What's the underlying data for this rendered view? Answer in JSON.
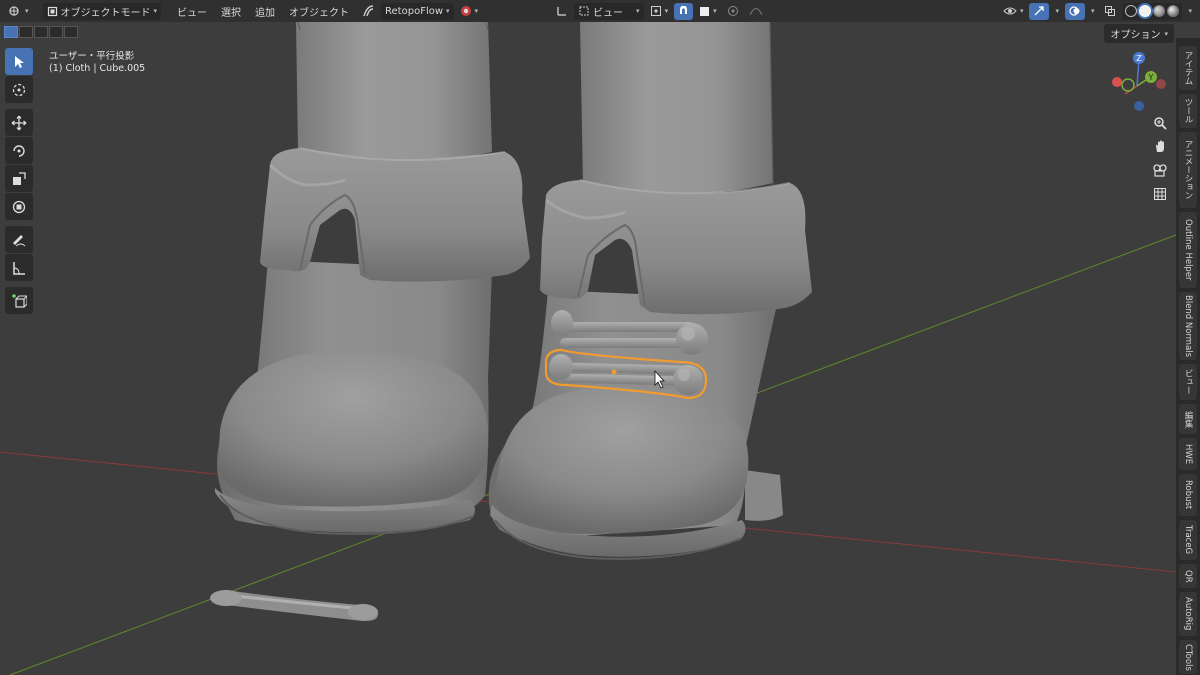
{
  "header": {
    "mode_label": "オブジェクトモード",
    "menus": [
      "ビュー",
      "選択",
      "追加",
      "オブジェクト"
    ],
    "addon_label": "RetopoFlow",
    "view_label": "ビュー"
  },
  "viewport": {
    "view_name": "ユーザー・平行投影",
    "object_info": "(1) Cloth | Cube.005",
    "options_label": "オプション"
  },
  "gizmo": {
    "z": "Z",
    "y": "Y"
  },
  "sidebar": {
    "tabs": [
      "アイテム",
      "ツール",
      "アニメーション",
      "Outline Helper",
      "Blend Normals",
      "ビュー",
      "編集",
      "HWE",
      "Robust",
      "TraceG",
      "QR",
      "AutoRig",
      "CTools"
    ]
  },
  "colors": {
    "header_bg": "#303030",
    "viewport_bg": "#3d3d3d",
    "accent": "#4772b3",
    "selection": "#f29b2f",
    "x_axis": "#8a3a3a",
    "y_axis": "#5f8a2c"
  }
}
